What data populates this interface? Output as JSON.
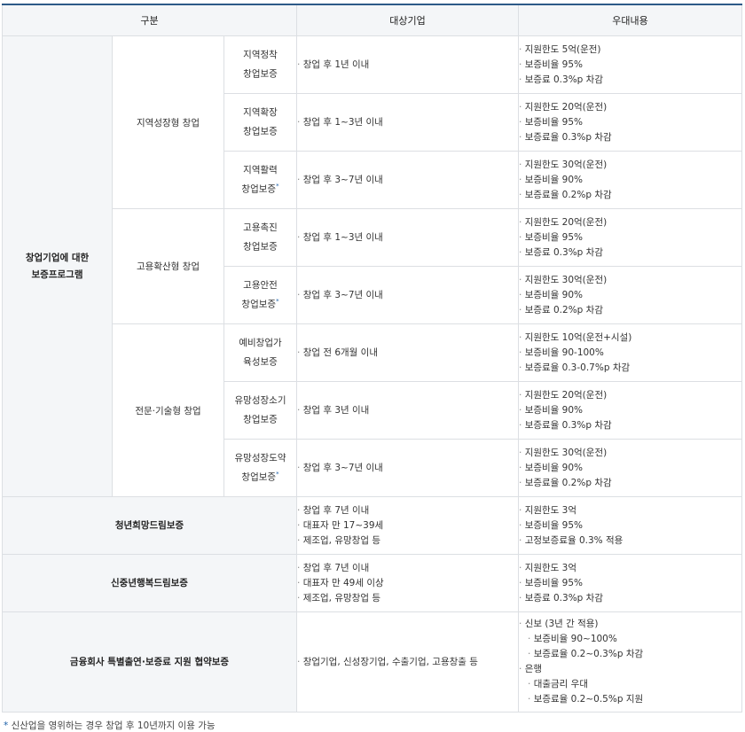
{
  "headers": {
    "category": "구분",
    "target": "대상기업",
    "benefit": "우대내용"
  },
  "startup": {
    "label_line1": "창업기업에 대한",
    "label_line2": "보증프로그램",
    "groups": [
      {
        "name": "지역성장형 창업",
        "programs": [
          {
            "line1": "지역정착",
            "line2": "창업보증",
            "star": "",
            "target": "창업 후 1년 이내",
            "benefits": [
              "지원한도 5억(운전)",
              "보증비율 95%",
              "보증료 0.3%p 차감"
            ]
          },
          {
            "line1": "지역확장",
            "line2": "창업보증",
            "star": "",
            "target": "창업 후 1~3년 이내",
            "benefits": [
              "지원한도 20억(운전)",
              "보증비율 95%",
              "보증료율 0.3%p 차감"
            ]
          },
          {
            "line1": "지역활력",
            "line2": "창업보증",
            "star": "*",
            "target": "창업 후 3~7년 이내",
            "benefits": [
              "지원한도 30억(운전)",
              "보증비율 90%",
              "보증료율 0.2%p 차감"
            ]
          }
        ]
      },
      {
        "name": "고용확산형 창업",
        "programs": [
          {
            "line1": "고용촉진",
            "line2": "창업보증",
            "star": "",
            "target": "창업 후 1~3년 이내",
            "benefits": [
              "지원한도 20억(운전)",
              "보증비율 95%",
              "보증료 0.3%p 차감"
            ]
          },
          {
            "line1": "고용안전",
            "line2": "창업보증",
            "star": "*",
            "target": "창업 후 3~7년 이내",
            "benefits": [
              "지원한도 30억(운전)",
              "보증비율 90%",
              "보증료 0.2%p 차감"
            ]
          }
        ]
      },
      {
        "name": "전문·기술형 창업",
        "programs": [
          {
            "line1": "예비창업가",
            "line2": "육성보증",
            "star": "",
            "target": "창업 전 6개월 이내",
            "benefits": [
              "지원한도 10억(운전+시설)",
              "보증비율 90-100%",
              "보증료율 0.3-0.7%p 차감"
            ]
          },
          {
            "line1": "유망성장소기",
            "line2": "창업보증",
            "star": "",
            "target": "창업 후 3년 이내",
            "benefits": [
              "지원한도 20억(운전)",
              "보증비율 90%",
              "보증료율 0.3%p 차감"
            ]
          },
          {
            "line1": "유망성장도약",
            "line2": "창업보증",
            "star": "*",
            "target": "창업 후 3~7년 이내",
            "benefits": [
              "지원한도 30억(운전)",
              "보증비율 90%",
              "보증료율 0.2%p 차감"
            ]
          }
        ]
      }
    ]
  },
  "youth": {
    "name": "청년희망드림보증",
    "targets": [
      "창업 후 7년 이내",
      "대표자 만 17~39세",
      "제조업, 유망창업 등"
    ],
    "benefits": [
      "지원한도 3억",
      "보증비율 95%",
      "고정보증료율 0.3% 적용"
    ]
  },
  "middle": {
    "name": "신중년행복드림보증",
    "targets": [
      "창업 후 7년 이내",
      "대표자 만 49세 이상",
      "제조업, 유망창업 등"
    ],
    "benefits": [
      "지원한도 3억",
      "보증비율 95%",
      "보증료 0.3%p 차감"
    ]
  },
  "finance": {
    "name": "금융회사 특별출연·보증료 지원 협약보증",
    "targets": [
      "창업기업, 신성장기업, 수출기업, 고용창출 등"
    ],
    "benefits": [
      {
        "text": "신보 (3년 간 적용)",
        "indent": false
      },
      {
        "text": "보증비율 90~100%",
        "indent": true
      },
      {
        "text": "보증료율 0.2~0.3%p 차감",
        "indent": true
      },
      {
        "text": "은행",
        "indent": false
      },
      {
        "text": "대출금리 우대",
        "indent": true
      },
      {
        "text": "보증료율 0.2~0.5%p 지원",
        "indent": true
      }
    ]
  },
  "footnote": {
    "star": "*",
    "text": "신산업을 영위하는 경우 창업 후 10년까지 이용 가능"
  }
}
